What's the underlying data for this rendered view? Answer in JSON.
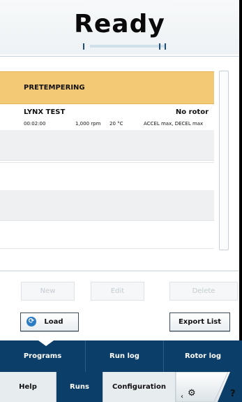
{
  "status": {
    "title": "Ready"
  },
  "programs": {
    "selected": {
      "name": "PRETEMPERING"
    },
    "detail": {
      "name": "LYNX TEST",
      "rotor": "No rotor",
      "duration": "00:02:00",
      "speed": "1,000 rpm",
      "temperature": "20 °C",
      "accel_decel": "ACCEL max, DECEL max"
    }
  },
  "actions": {
    "new_label": "New",
    "edit_label": "Edit",
    "delete_label": "Delete",
    "load_label": "Load",
    "export_label": "Export List"
  },
  "nav": {
    "top_tabs": [
      "Programs",
      "Run log",
      "Rotor log"
    ],
    "bottom_tabs": [
      "Help",
      "Runs",
      "Configuration"
    ],
    "settings_chevron": "‹",
    "help_symbol": "?"
  },
  "colors": {
    "accent": "#0b3e69",
    "selected_row": "#f4c975",
    "load_icon": "#2b7cc4"
  },
  "icons": {
    "load": "refresh-icon",
    "settings": "gears-icon"
  }
}
